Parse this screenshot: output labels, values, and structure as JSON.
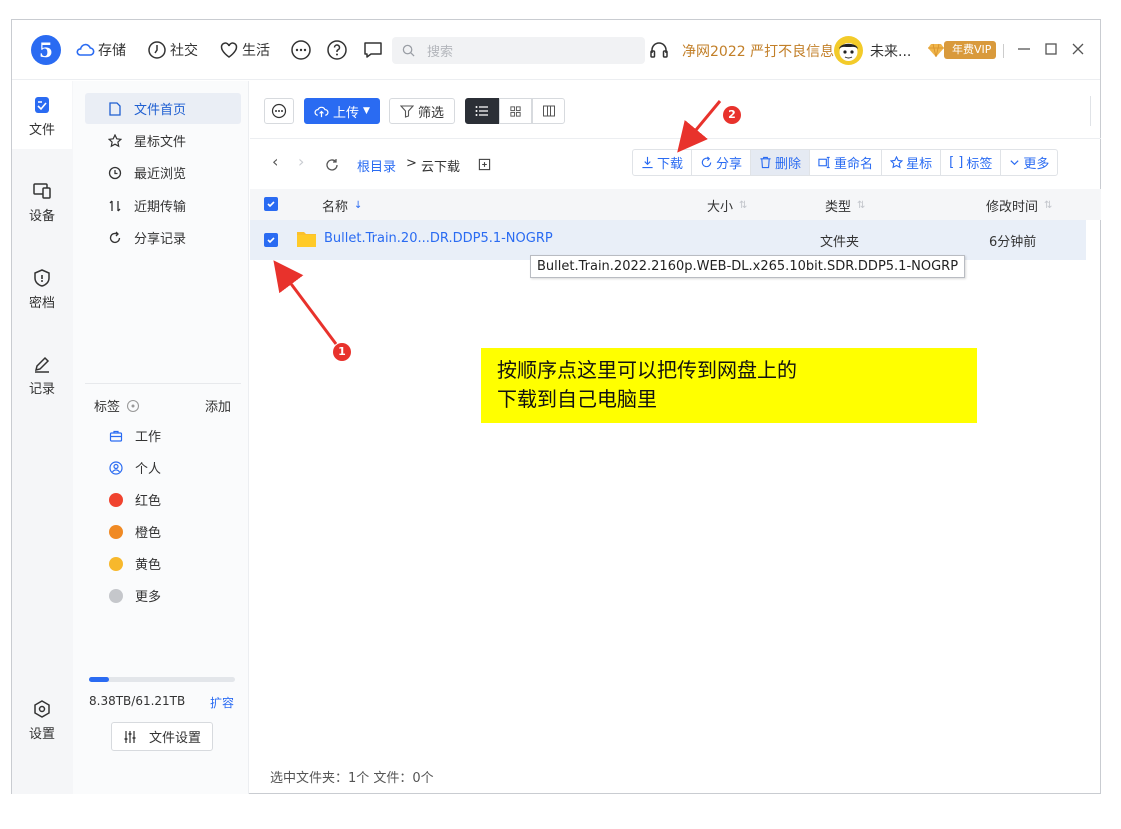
{
  "topnav": {
    "storage": "存储",
    "social": "社交",
    "life": "生活",
    "search_placeholder": "搜索",
    "promo": "净网2022 严打不良信息",
    "user_name": "未来...",
    "vip": "年费VIP"
  },
  "rail": {
    "files": "文件",
    "devices": "设备",
    "vault": "密档",
    "records": "记录",
    "settings": "设置"
  },
  "sidebar": {
    "items": [
      {
        "label": "文件首页"
      },
      {
        "label": "星标文件"
      },
      {
        "label": "最近浏览"
      },
      {
        "label": "近期传输"
      },
      {
        "label": "分享记录"
      }
    ],
    "tags_title": "标签",
    "tags_add": "添加",
    "tags": [
      {
        "label": "工作"
      },
      {
        "label": "个人"
      },
      {
        "label": "红色",
        "color": "#f0432f"
      },
      {
        "label": "橙色",
        "color": "#f08a24"
      },
      {
        "label": "黄色",
        "color": "#f7b82c"
      },
      {
        "label": "更多",
        "color": "#c5c7cb"
      }
    ],
    "storage_text": "8.38TB/61.21TB",
    "storage_used_fraction": 0.137,
    "expand": "扩容",
    "file_settings": "文件设置"
  },
  "toolbar": {
    "upload": "上传",
    "filter": "筛选"
  },
  "path": {
    "root": "根目录",
    "sep": ">",
    "current": "云下载"
  },
  "actions": {
    "download": "下载",
    "share": "分享",
    "delete": "删除",
    "rename": "重命名",
    "star": "星标",
    "tag": "标签",
    "more": "更多"
  },
  "table": {
    "headers": {
      "name": "名称",
      "size": "大小",
      "type": "类型",
      "modified": "修改时间"
    },
    "rows": [
      {
        "name": "Bullet.Train.20...DR.DDP5.1-NOGRP",
        "size": "",
        "type": "文件夹",
        "modified": "6分钟前"
      }
    ]
  },
  "tooltip": "Bullet.Train.2022.2160p.WEB-DL.x265.10bit.SDR.DDP5.1-NOGRP",
  "annotation": {
    "line1": "按顺序点这里可以把传到网盘上的",
    "line2": "下载到自己电脑里",
    "badge1": "1",
    "badge2": "2"
  },
  "status": "选中文件夹：1个 文件：0个",
  "colors": {
    "accent": "#2a6bf2",
    "highlight": "#ffff00",
    "marker": "#e8322c"
  }
}
